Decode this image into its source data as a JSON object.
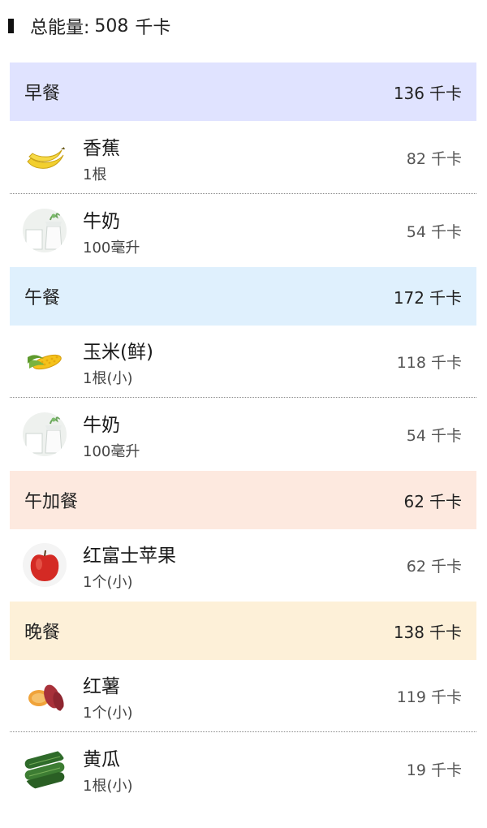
{
  "summary": {
    "label": "总能量:",
    "total_kcal": "508",
    "unit": "千卡"
  },
  "meals": [
    {
      "name": "早餐",
      "kcal": "136",
      "unit": "千卡",
      "color": "#e0e3ff",
      "items": [
        {
          "name": "香蕉",
          "amount": "1根",
          "kcal": "82",
          "unit": "千卡",
          "icon": "banana-icon"
        },
        {
          "name": "牛奶",
          "amount": "100毫升",
          "kcal": "54",
          "unit": "千卡",
          "icon": "milk-icon"
        }
      ]
    },
    {
      "name": "午餐",
      "kcal": "172",
      "unit": "千卡",
      "color": "#dff0fd",
      "items": [
        {
          "name": "玉米(鲜)",
          "amount": "1根(小)",
          "kcal": "118",
          "unit": "千卡",
          "icon": "corn-icon"
        },
        {
          "name": "牛奶",
          "amount": "100毫升",
          "kcal": "54",
          "unit": "千卡",
          "icon": "milk-icon"
        }
      ]
    },
    {
      "name": "午加餐",
      "kcal": "62",
      "unit": "千卡",
      "color": "#fde9df",
      "items": [
        {
          "name": "红富士苹果",
          "amount": "1个(小)",
          "kcal": "62",
          "unit": "千卡",
          "icon": "apple-icon"
        }
      ]
    },
    {
      "name": "晚餐",
      "kcal": "138",
      "unit": "千卡",
      "color": "#fdf0d8",
      "items": [
        {
          "name": "红薯",
          "amount": "1个(小)",
          "kcal": "119",
          "unit": "千卡",
          "icon": "sweet-potato-icon"
        },
        {
          "name": "黄瓜",
          "amount": "1根(小)",
          "kcal": "19",
          "unit": "千卡",
          "icon": "cucumber-icon"
        }
      ]
    }
  ]
}
